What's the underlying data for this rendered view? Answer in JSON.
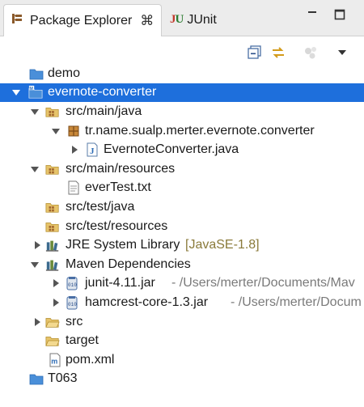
{
  "tabs": [
    {
      "label": "Package Explorer",
      "icon": "package-explorer-icon",
      "active": true,
      "close_glyph": "⌘"
    },
    {
      "label": "JUnit",
      "icon": "junit-icon",
      "logo_j": "J",
      "logo_u": "U"
    }
  ],
  "colors": {
    "selection": "#1e6fdc",
    "folder_blue": "#4a8fd9",
    "folder_tan": "#e6c36a",
    "decoration": "#8a7a3a",
    "path_gray": "#7a7a7a"
  },
  "tree": {
    "rows": [
      {
        "label": "demo",
        "icon": "project-folder-icon"
      },
      {
        "label": "evernote-converter",
        "icon": "maven-project-icon",
        "selected": true,
        "expanded": true
      },
      {
        "label": "src/main/java",
        "icon": "source-folder-icon",
        "expanded": true
      },
      {
        "label": "tr.name.sualp.merter.evernote.converter",
        "icon": "package-icon",
        "expanded": true
      },
      {
        "label": "EvernoteConverter.java",
        "icon": "java-file-icon",
        "collapsed": true
      },
      {
        "label": "src/main/resources",
        "icon": "source-folder-icon",
        "expanded": true
      },
      {
        "label": "everTest.txt",
        "icon": "text-file-icon"
      },
      {
        "label": "src/test/java",
        "icon": "source-folder-icon"
      },
      {
        "label": "src/test/resources",
        "icon": "source-folder-icon"
      },
      {
        "label": "JRE System Library",
        "decoration": "[JavaSE-1.8]",
        "icon": "library-icon",
        "collapsed": true
      },
      {
        "label": "Maven Dependencies",
        "icon": "library-icon",
        "expanded": true
      },
      {
        "label": "junit-4.11.jar",
        "decoration": " - /Users/merter/Documents/Mav",
        "icon": "jar-icon",
        "collapsed": true
      },
      {
        "label": "hamcrest-core-1.3.jar",
        "decoration": " - /Users/merter/Docum",
        "icon": "jar-icon",
        "collapsed": true
      },
      {
        "label": "src",
        "icon": "folder-icon",
        "collapsed": true
      },
      {
        "label": "target",
        "icon": "folder-icon"
      },
      {
        "label": "pom.xml",
        "icon": "maven-pom-icon"
      },
      {
        "label": "T063",
        "icon": "project-folder-icon"
      }
    ]
  }
}
